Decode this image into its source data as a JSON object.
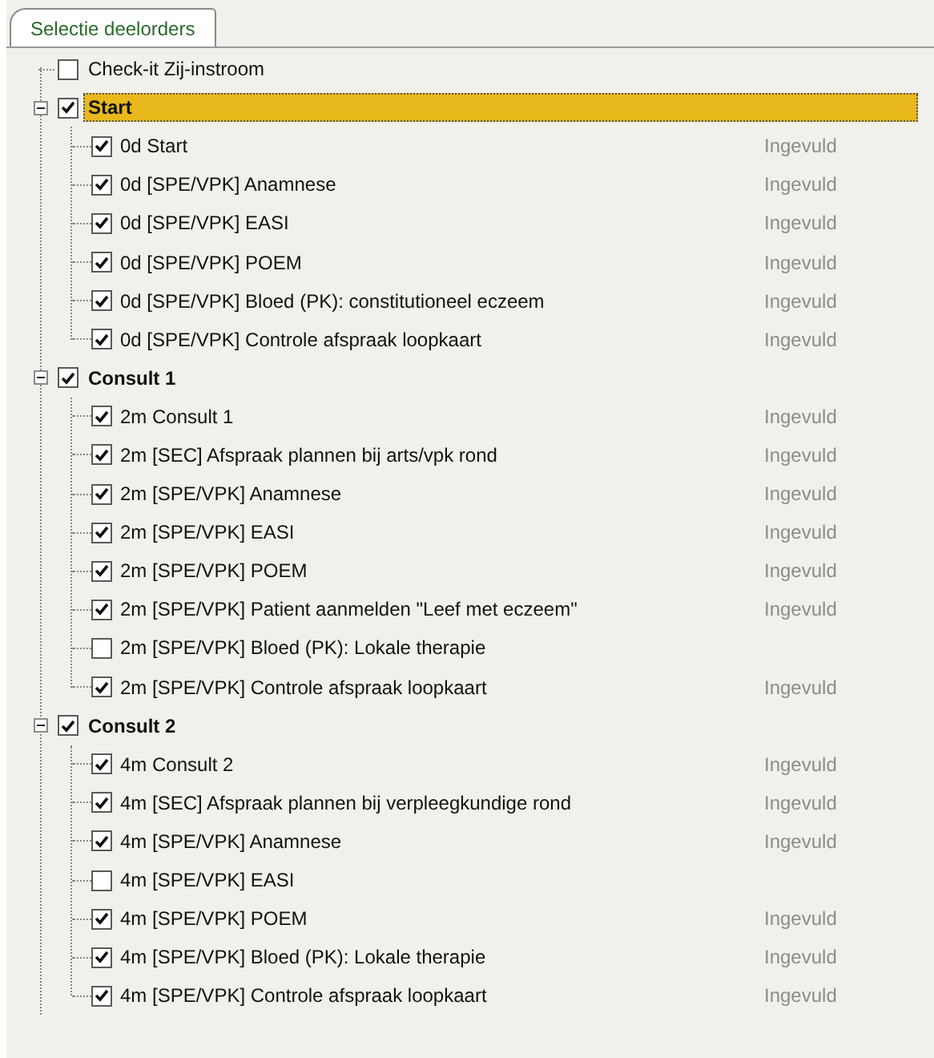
{
  "tabs": [
    {
      "label": "Selectie deelorders",
      "selected": true
    }
  ],
  "tree": [
    {
      "label": "Check-it Zij-instroom",
      "checked": false,
      "selected": false
    },
    {
      "label": "Start",
      "checked": true,
      "selected": true,
      "expanded": true,
      "children": [
        {
          "label": "0d Start",
          "checked": true,
          "selected": false,
          "status": "Ingevuld"
        },
        {
          "label": "0d [SPE/VPK] Anamnese",
          "checked": true,
          "selected": false,
          "status": "Ingevuld"
        },
        {
          "label": "0d [SPE/VPK] EASI",
          "checked": true,
          "selected": false,
          "status": "Ingevuld"
        },
        {
          "label": "0d [SPE/VPK] POEM",
          "checked": true,
          "selected": false,
          "status": "Ingevuld"
        },
        {
          "label": "0d [SPE/VPK] Bloed (PK): constitutioneel eczeem",
          "checked": true,
          "selected": false,
          "status": "Ingevuld"
        },
        {
          "label": "0d [SPE/VPK] Controle afspraak loopkaart",
          "checked": true,
          "selected": false,
          "status": "Ingevuld"
        }
      ]
    },
    {
      "label": "Consult 1",
      "checked": true,
      "selected": false,
      "expanded": true,
      "children": [
        {
          "label": "2m Consult 1",
          "checked": true,
          "selected": false,
          "status": "Ingevuld"
        },
        {
          "label": "2m [SEC] Afspraak plannen bij arts/vpk rond",
          "checked": true,
          "selected": false,
          "status": "Ingevuld"
        },
        {
          "label": "2m [SPE/VPK] Anamnese",
          "checked": true,
          "selected": false,
          "status": "Ingevuld"
        },
        {
          "label": "2m [SPE/VPK] EASI",
          "checked": true,
          "selected": false,
          "status": "Ingevuld"
        },
        {
          "label": "2m [SPE/VPK] POEM",
          "checked": true,
          "selected": false,
          "status": "Ingevuld"
        },
        {
          "label": "2m [SPE/VPK] Patient aanmelden \"Leef met eczeem\"",
          "checked": true,
          "selected": false,
          "status": "Ingevuld"
        },
        {
          "label": "2m [SPE/VPK] Bloed (PK): Lokale therapie",
          "checked": false,
          "selected": false
        },
        {
          "label": "2m [SPE/VPK] Controle afspraak loopkaart",
          "checked": true,
          "selected": false,
          "status": "Ingevuld"
        }
      ]
    },
    {
      "label": "Consult 2",
      "checked": true,
      "selected": false,
      "expanded": true,
      "children": [
        {
          "label": "4m Consult 2",
          "checked": true,
          "selected": false,
          "status": "Ingevuld"
        },
        {
          "label": "4m [SEC] Afspraak plannen bij verpleegkundige rond",
          "checked": true,
          "selected": false,
          "status": "Ingevuld"
        },
        {
          "label": "4m [SPE/VPK] Anamnese",
          "checked": true,
          "selected": false,
          "status": "Ingevuld"
        },
        {
          "label": "4m [SPE/VPK] EASI",
          "checked": false,
          "selected": false
        },
        {
          "label": "4m [SPE/VPK] POEM",
          "checked": true,
          "selected": false,
          "status": "Ingevuld"
        },
        {
          "label": "4m [SPE/VPK] Bloed (PK): Lokale therapie",
          "checked": true,
          "selected": false,
          "status": "Ingevuld"
        },
        {
          "label": "4m [SPE/VPK] Controle afspraak loopkaart",
          "checked": true,
          "selected": false,
          "status": "Ingevuld"
        }
      ]
    }
  ]
}
